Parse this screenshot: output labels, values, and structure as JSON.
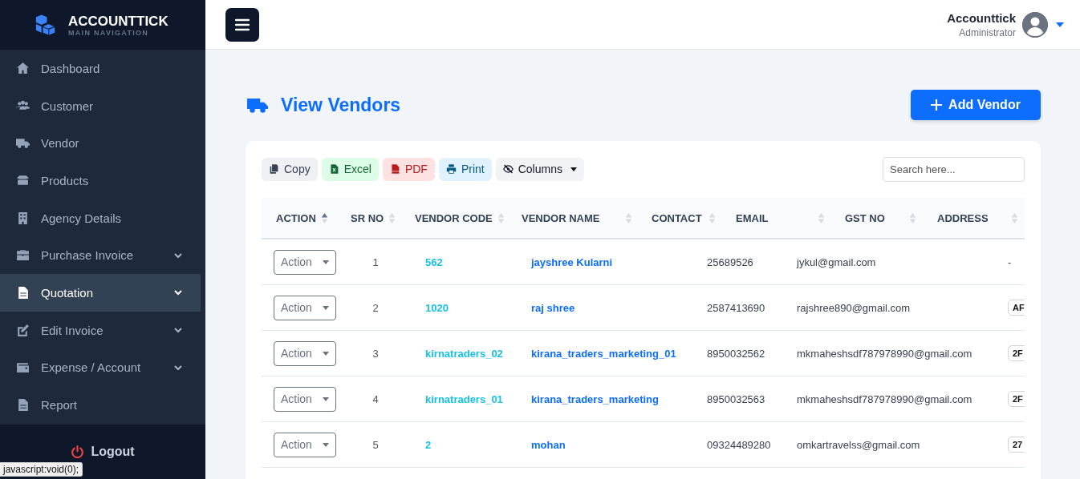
{
  "brand": {
    "name": "ACCOUNTTICK",
    "subtitle": "MAIN NAVIGATION"
  },
  "sidebar": {
    "items": [
      {
        "label": "Dashboard",
        "expandable": false,
        "selected": false
      },
      {
        "label": "Customer",
        "expandable": false,
        "selected": false
      },
      {
        "label": "Vendor",
        "expandable": false,
        "selected": false
      },
      {
        "label": "Products",
        "expandable": false,
        "selected": false
      },
      {
        "label": "Agency Details",
        "expandable": false,
        "selected": false
      },
      {
        "label": "Purchase Invoice",
        "expandable": true,
        "selected": false
      },
      {
        "label": "Quotation",
        "expandable": true,
        "selected": true
      },
      {
        "label": "Edit Invoice",
        "expandable": true,
        "selected": false
      },
      {
        "label": "Expense / Account",
        "expandable": true,
        "selected": false
      },
      {
        "label": "Report",
        "expandable": false,
        "selected": false
      }
    ],
    "logout": "Logout"
  },
  "status_bar": {
    "text": "javascript:void(0);"
  },
  "user": {
    "name": "Accounttick",
    "role": "Administrator"
  },
  "page": {
    "title": "View Vendors",
    "add_button": "Add Vendor"
  },
  "toolbar": {
    "buttons": [
      {
        "label": "Copy",
        "kind": "copy"
      },
      {
        "label": "Excel",
        "kind": "excel"
      },
      {
        "label": "PDF",
        "kind": "pdf"
      },
      {
        "label": "Print",
        "kind": "print"
      },
      {
        "label": "Columns",
        "kind": "columns"
      }
    ],
    "search": {
      "placeholder": "Search here..."
    }
  },
  "table": {
    "columns": [
      {
        "label": "ACTION",
        "sorted": true
      },
      {
        "label": "SR NO",
        "sorted": false
      },
      {
        "label": "VENDOR CODE",
        "sorted": false
      },
      {
        "label": "VENDOR NAME",
        "sorted": false
      },
      {
        "label": "CONTACT",
        "sorted": false
      },
      {
        "label": "EMAIL",
        "sorted": false
      },
      {
        "label": "GST NO",
        "sorted": false
      },
      {
        "label": "ADDRESS",
        "sorted": false
      }
    ],
    "rows": [
      {
        "action": "Action",
        "sr_no": "1",
        "vendor_code": "562",
        "vendor_name": "jayshree Kularni",
        "contact": "25689526",
        "email": "jykul@gmail.com",
        "column_7": {
          "text": "-",
          "kind": "plain"
        }
      },
      {
        "action": "Action",
        "sr_no": "2",
        "vendor_code": "1020",
        "vendor_name": "raj shree",
        "contact": "2587413690",
        "email": "rajshree890@gmail.com",
        "column_7": {
          "text": "AF",
          "kind": "badge"
        }
      },
      {
        "action": "Action",
        "sr_no": "3",
        "vendor_code": "kirnatraders_02",
        "vendor_name": "kirana_traders_marketing_01",
        "contact": "8950032562",
        "email": "mkmaheshsdf787978990@gmail.com",
        "column_7": {
          "text": "2F",
          "kind": "badge"
        }
      },
      {
        "action": "Action",
        "sr_no": "4",
        "vendor_code": "kirnatraders_01",
        "vendor_name": "kirana_traders_marketing",
        "contact": "8950032563",
        "email": "mkmaheshsdf787978990@gmail.com",
        "column_7": {
          "text": "2F",
          "kind": "badge"
        }
      },
      {
        "action": "Action",
        "sr_no": "5",
        "vendor_code": "2",
        "vendor_name": "mohan",
        "contact": "09324489280",
        "email": "omkartravelss@gmail.com",
        "column_7": {
          "text": "27",
          "kind": "badge"
        }
      }
    ]
  }
}
